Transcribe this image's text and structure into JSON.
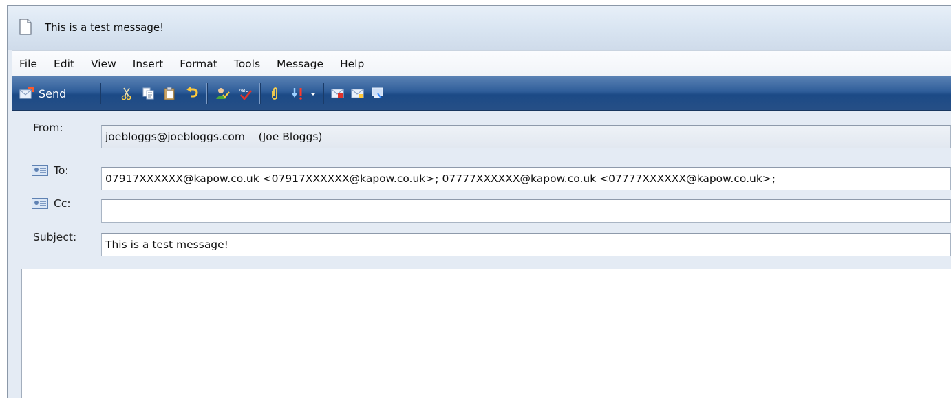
{
  "window": {
    "title": "This is a test message!",
    "icon": "document-icon"
  },
  "menu": [
    "File",
    "Edit",
    "View",
    "Insert",
    "Format",
    "Tools",
    "Message",
    "Help"
  ],
  "toolbar": {
    "send_label": "Send",
    "buttons": [
      "cut-icon",
      "copy-icon",
      "paste-icon",
      "undo-icon",
      "check-names-icon",
      "spelling-icon",
      "attach-icon",
      "priority-icon",
      "priority-dropdown-icon",
      "sign-icon",
      "encrypt-icon",
      "work-offline-icon"
    ]
  },
  "fields": {
    "from": {
      "label": "From:",
      "value": "joebloggs@joebloggs.com    (Joe Bloggs)"
    },
    "to": {
      "label": "To:",
      "recipients": [
        "07917XXXXXX@kapow.co.uk <07917XXXXXX@kapow.co.uk>",
        "07777XXXXXX@kapow.co.uk <07777XXXXXX@kapow.co.uk>"
      ],
      "separator": ";"
    },
    "cc": {
      "label": "Cc:",
      "value": ""
    },
    "subject": {
      "label": "Subject:",
      "value": "This is a test message!"
    }
  },
  "body": {
    "text": ""
  },
  "colors": {
    "toolbar": "#2f5e9a",
    "window_bg": "#e4ebf4",
    "field_border": "#a9b5c4"
  }
}
